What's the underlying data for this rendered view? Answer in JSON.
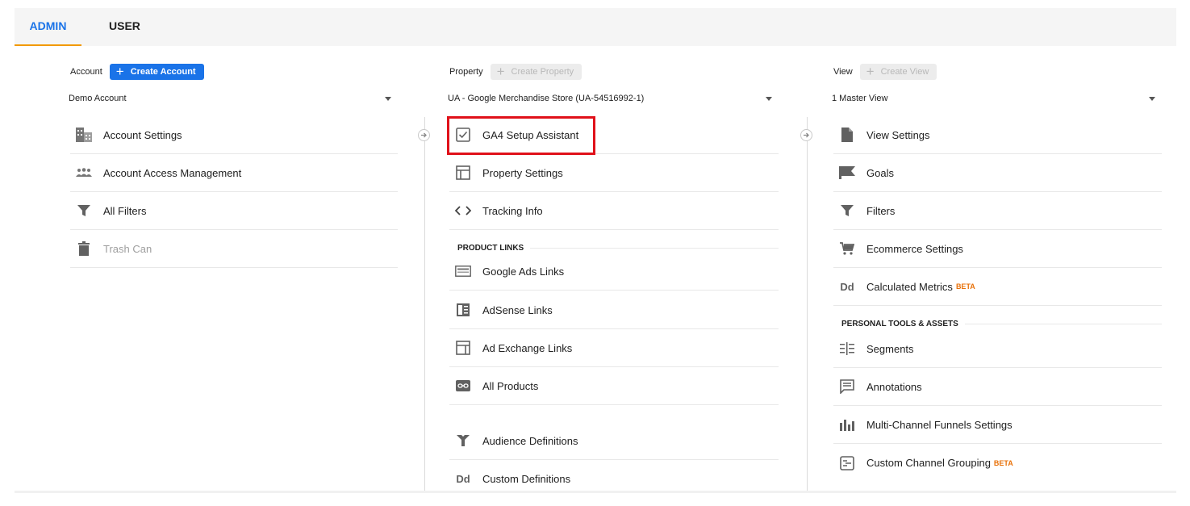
{
  "tabs": {
    "admin": "ADMIN",
    "user": "USER"
  },
  "account": {
    "label": "Account",
    "create_button": "Create Account",
    "selected": "Demo Account",
    "items": [
      {
        "label": "Account Settings",
        "icon": "building-icon"
      },
      {
        "label": "Account Access Management",
        "icon": "people-icon"
      },
      {
        "label": "All Filters",
        "icon": "filter-icon"
      },
      {
        "label": "Trash Can",
        "icon": "trash-icon"
      }
    ]
  },
  "property": {
    "label": "Property",
    "create_button": "Create Property",
    "selected": "UA - Google Merchandise Store (UA-54516992-1)",
    "items": [
      {
        "label": "GA4 Setup Assistant",
        "icon": "checkbox-icon"
      },
      {
        "label": "Property Settings",
        "icon": "window-icon"
      },
      {
        "label": "Tracking Info",
        "icon": "code-icon"
      }
    ],
    "section_product_links": "PRODUCT LINKS",
    "product_links": [
      {
        "label": "Google Ads Links",
        "icon": "google-ads-icon"
      },
      {
        "label": "AdSense Links",
        "icon": "adsense-icon"
      },
      {
        "label": "Ad Exchange Links",
        "icon": "ad-exchange-icon"
      },
      {
        "label": "All Products",
        "icon": "link-icon"
      }
    ],
    "more": [
      {
        "label": "Audience Definitions",
        "icon": "fork-icon"
      },
      {
        "label": "Custom Definitions",
        "icon": "dd-icon"
      }
    ]
  },
  "view": {
    "label": "View",
    "create_button": "Create View",
    "selected": "1 Master View",
    "items": [
      {
        "label": "View Settings",
        "icon": "document-icon"
      },
      {
        "label": "Goals",
        "icon": "flag-icon"
      },
      {
        "label": "Filters",
        "icon": "filter-icon"
      },
      {
        "label": "Ecommerce Settings",
        "icon": "cart-icon"
      },
      {
        "label": "Calculated Metrics",
        "icon": "dd-icon",
        "badge": "BETA"
      }
    ],
    "section_personal": "PERSONAL TOOLS & ASSETS",
    "personal": [
      {
        "label": "Segments",
        "icon": "segments-icon"
      },
      {
        "label": "Annotations",
        "icon": "comment-icon"
      },
      {
        "label": "Multi-Channel Funnels Settings",
        "icon": "bar-chart-icon"
      },
      {
        "label": "Custom Channel Grouping",
        "icon": "channel-grouping-icon",
        "badge": "BETA"
      }
    ]
  },
  "colors": {
    "accent": "#1a73e8",
    "tab_underline": "#f29900",
    "highlight": "#e0111a",
    "beta": "#e8710a"
  }
}
